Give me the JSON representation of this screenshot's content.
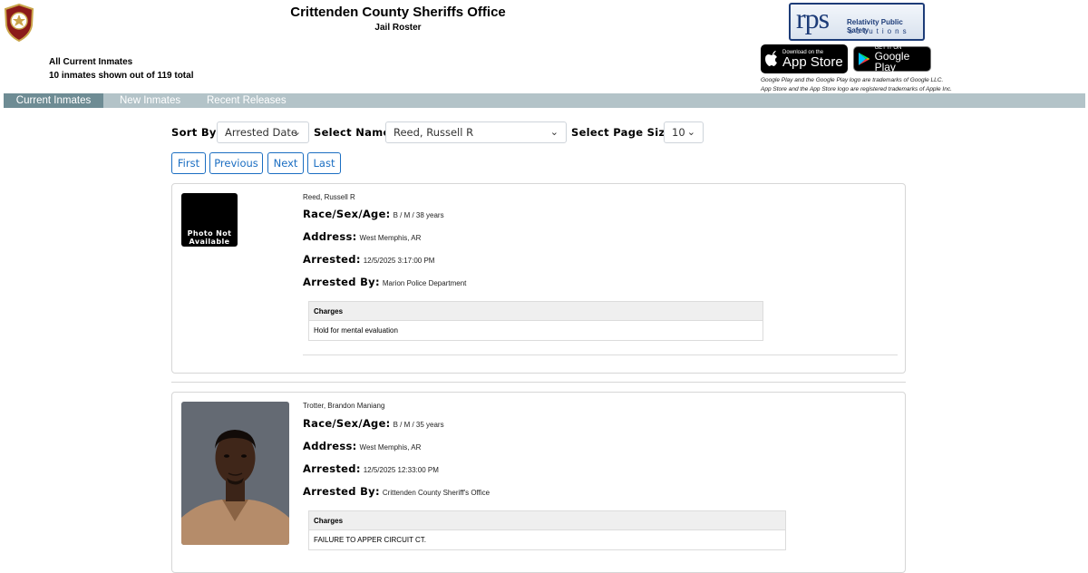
{
  "header": {
    "title": "Crittenden County Sheriffs Office",
    "subtitle": "Jail Roster",
    "roster_heading": "All Current Inmates",
    "roster_count": "10 inmates shown out of 119 total"
  },
  "partner_logo": {
    "big": "rps",
    "line1": "Relativity Public Safety",
    "line2": "solutions"
  },
  "store_badges": {
    "appstore_small": "Download on the",
    "appstore_big": "App Store",
    "googleplay_small": "GET IT ON",
    "googleplay_big": "Google Play"
  },
  "disclaimer": {
    "line1": "Google Play and the Google Play logo are trademarks of Google LLC.",
    "line2": "App Store and the App Store logo are registered trademarks of Apple Inc."
  },
  "tabs": [
    {
      "label": "Current Inmates",
      "active": true
    },
    {
      "label": "New Inmates",
      "active": false
    },
    {
      "label": "Recent Releases",
      "active": false
    }
  ],
  "controls": {
    "sort_by_label": "Sort By:",
    "sort_by_value": "Arrested Date",
    "select_name_label": "Select Name:",
    "select_name_value": "Reed, Russell R",
    "page_size_label": "Select Page Size:",
    "page_size_value": "10"
  },
  "pager": {
    "first": "First",
    "previous": "Previous",
    "next": "Next",
    "last": "Last"
  },
  "labels": {
    "race_sex_age": "Race/Sex/Age:",
    "address": "Address:",
    "arrested": "Arrested:",
    "arrested_by": "Arrested By:",
    "charges": "Charges",
    "photo_na_line1": "Photo Not",
    "photo_na_line2": "Available"
  },
  "inmates": [
    {
      "name": "Reed, Russell R",
      "race_sex_age": "B / M / 38 years",
      "address": "West Memphis, AR",
      "arrested": "12/5/2025 3:17:00 PM",
      "arrested_by": "Marion Police Department",
      "charges": [
        "Hold for mental evaluation"
      ]
    },
    {
      "name": "Trotter, Brandon Maniang",
      "race_sex_age": "B / M / 35 years",
      "address": "West Memphis, AR",
      "arrested": "12/5/2025 12:33:00 PM",
      "arrested_by": "Crittenden County Sheriff's Office",
      "charges": [
        "FAILURE TO APPER CIRCUIT CT."
      ]
    }
  ],
  "colors": {
    "tab_bar": "#b3c3c8",
    "tab_active": "#6e8c94",
    "button_blue": "#1b6ec2",
    "logo_navy": "#1d3c78"
  },
  "icons": {
    "sheriff_badge": "sheriff-badge-icon",
    "apple": "apple-icon",
    "google_play": "google-play-icon",
    "chevron": "chevron-down-icon"
  }
}
